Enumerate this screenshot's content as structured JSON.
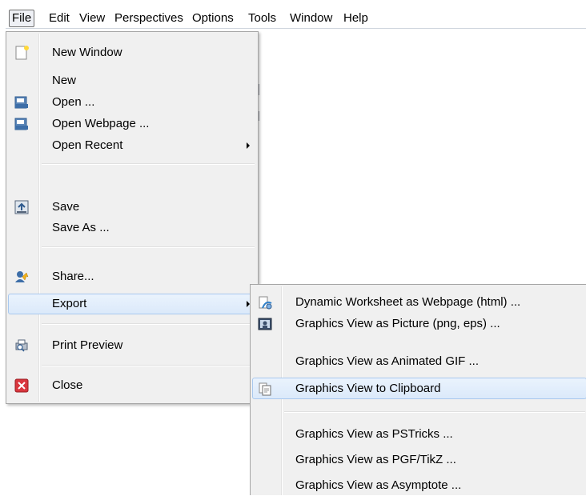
{
  "menubar": {
    "items": [
      "File",
      "Edit",
      "View",
      "Perspectives",
      "Options",
      "Tools",
      "Window",
      "Help"
    ]
  },
  "file_menu": {
    "new_window": "New Window",
    "new": "New",
    "open": "Open ...",
    "open_webpage": "Open Webpage ...",
    "open_recent": "Open Recent",
    "save": "Save",
    "save_as": "Save As ...",
    "share": "Share...",
    "export": "Export",
    "print_preview": "Print Preview",
    "close": "Close"
  },
  "export_menu": {
    "worksheet_html": "Dynamic Worksheet as Webpage (html) ...",
    "picture": "Graphics View as Picture (png, eps) ...",
    "animated_gif": "Graphics View as Animated GIF ...",
    "clipboard": "Graphics View to Clipboard",
    "pstricks": "Graphics View as PSTricks ...",
    "pgf_tikz": "Graphics View as PGF/TikZ ...",
    "asymptote": "Graphics View as Asymptote ..."
  },
  "colors": {
    "highlight_border": "#a8c8ee",
    "menu_bg": "#f0f0f0"
  }
}
